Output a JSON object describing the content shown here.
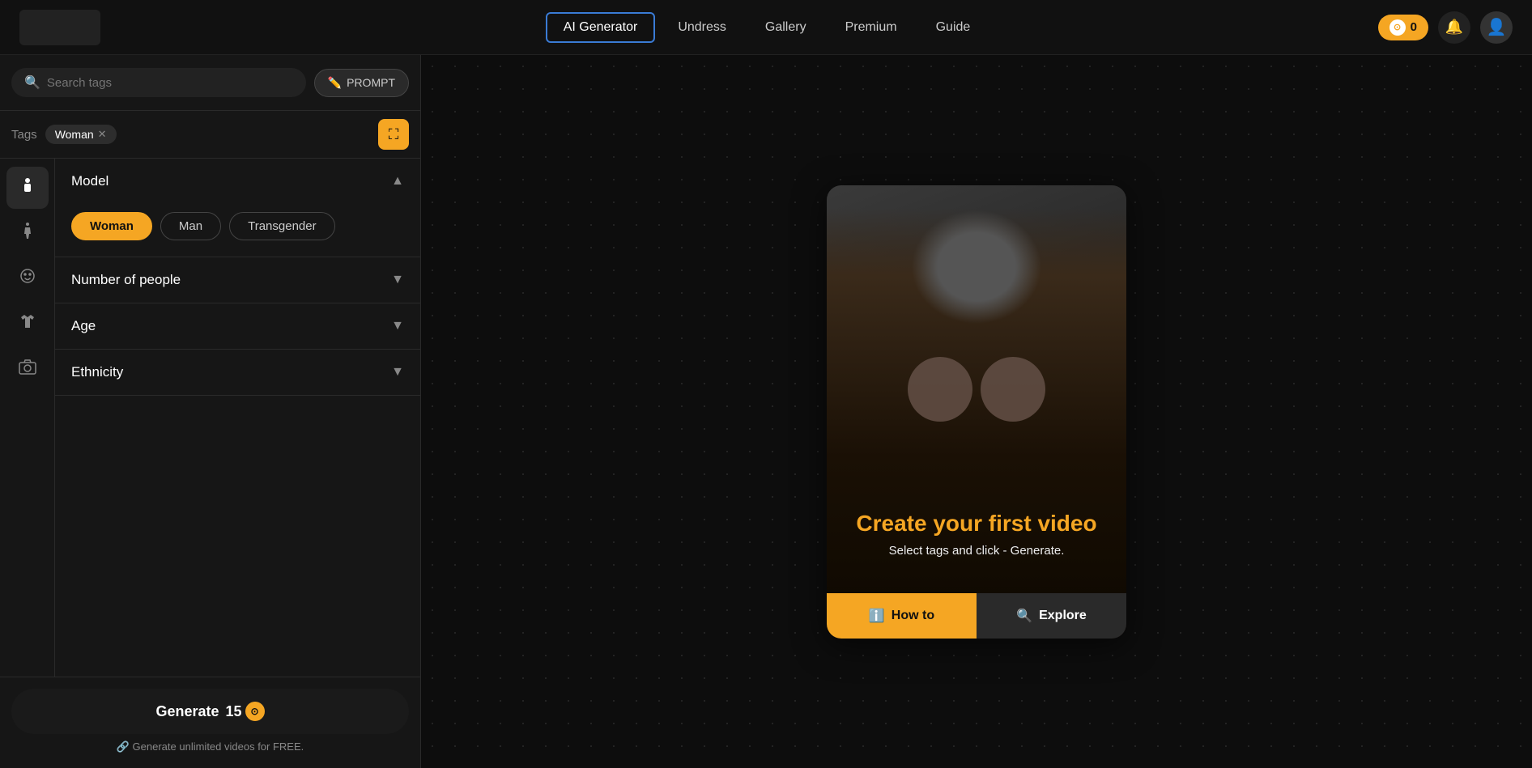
{
  "navbar": {
    "links": [
      {
        "id": "ai-generator",
        "label": "AI Generator",
        "active": true
      },
      {
        "id": "undress",
        "label": "Undress",
        "active": false
      },
      {
        "id": "gallery",
        "label": "Gallery",
        "active": false
      },
      {
        "id": "premium",
        "label": "Premium",
        "active": false
      },
      {
        "id": "guide",
        "label": "Guide",
        "active": false
      }
    ],
    "coins": "0",
    "coin_symbol": "⊙"
  },
  "sidebar": {
    "search": {
      "placeholder": "Search tags",
      "prompt_btn": "PROMPT"
    },
    "tags_label": "Tags",
    "active_tags": [
      {
        "id": "woman",
        "label": "Woman"
      }
    ],
    "filter_sections": [
      {
        "id": "model",
        "label": "Model",
        "expanded": true,
        "options": [
          {
            "id": "woman",
            "label": "Woman",
            "selected": true
          },
          {
            "id": "man",
            "label": "Man",
            "selected": false
          },
          {
            "id": "transgender",
            "label": "Transgender",
            "selected": false
          }
        ]
      },
      {
        "id": "number-of-people",
        "label": "Number of people",
        "expanded": false
      },
      {
        "id": "age",
        "label": "Age",
        "expanded": false
      },
      {
        "id": "ethnicity",
        "label": "Ethnicity",
        "expanded": false
      }
    ],
    "side_icons": [
      {
        "id": "person",
        "label": "Person",
        "active": true,
        "symbol": "👤"
      },
      {
        "id": "body",
        "label": "Body",
        "active": false,
        "symbol": "🏃"
      },
      {
        "id": "face",
        "label": "Face",
        "active": false,
        "symbol": "👩"
      },
      {
        "id": "clothing",
        "label": "Clothing",
        "active": false,
        "symbol": "👕"
      },
      {
        "id": "camera",
        "label": "Camera",
        "active": false,
        "symbol": "📷"
      }
    ]
  },
  "generate": {
    "label": "Generate",
    "cost": "15",
    "unlimited_text": "Generate unlimited videos for FREE."
  },
  "video_card": {
    "overlay_title": "Create your first video",
    "overlay_subtitle": "Select tags and click - Generate.",
    "how_to_label": "How to",
    "explore_label": "Explore"
  }
}
